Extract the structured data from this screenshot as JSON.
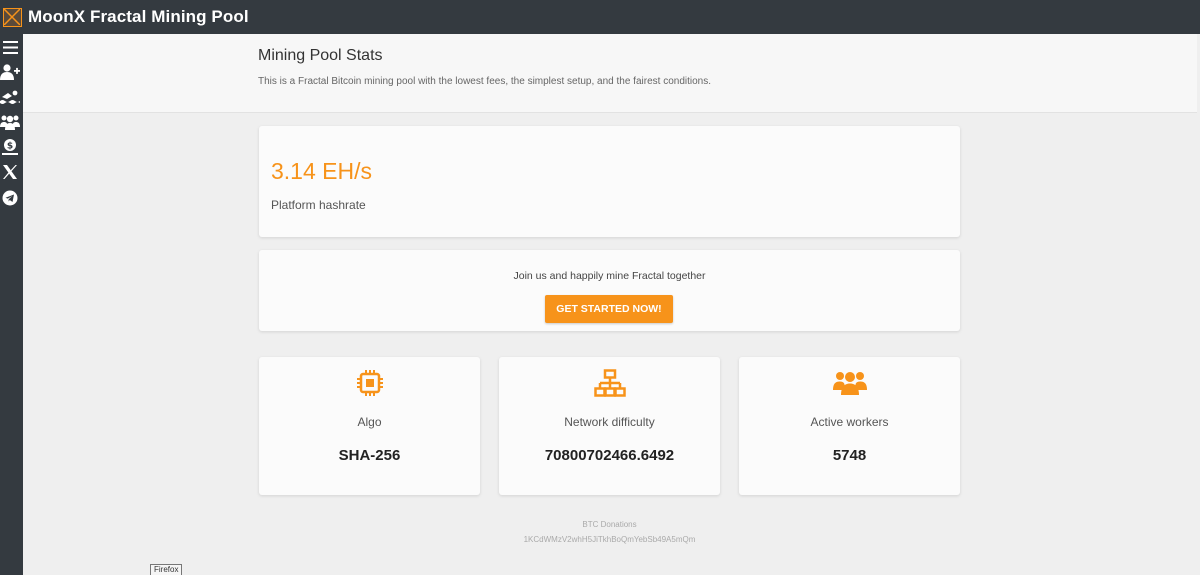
{
  "app": {
    "title": "MoonX Fractal Mining Pool",
    "logo_icon": "moonx-logo-icon",
    "accent_color": "#f7931a",
    "topbar_color": "#343a40"
  },
  "sidebar": {
    "items": [
      {
        "icon": "menu-icon"
      },
      {
        "icon": "add-user-icon"
      },
      {
        "icon": "swimmer-icon"
      },
      {
        "icon": "users-icon"
      },
      {
        "icon": "money-hand-icon"
      },
      {
        "icon": "x-twitter-icon"
      },
      {
        "icon": "telegram-icon"
      }
    ]
  },
  "header": {
    "title": "Mining Pool Stats",
    "subtitle": "This is a Fractal Bitcoin mining pool with the lowest fees, the simplest setup, and the fairest conditions."
  },
  "hashrate": {
    "value": "3.14 EH/s",
    "label": "Platform hashrate"
  },
  "join": {
    "text": "Join us and happily mine Fractal together",
    "button": "GET STARTED NOW!"
  },
  "stats": [
    {
      "icon": "cpu-chip-icon",
      "label": "Algo",
      "value": "SHA-256"
    },
    {
      "icon": "network-icon",
      "label": "Network difficulty",
      "value": "70800702466.6492"
    },
    {
      "icon": "users-icon",
      "label": "Active workers",
      "value": "5748"
    }
  ],
  "donation": {
    "label": "BTC Donations",
    "address": "1KCdWMzV2whH5JiTkhBoQmYebSb49A5mQm"
  },
  "tooltip": {
    "text": "Firefox"
  }
}
